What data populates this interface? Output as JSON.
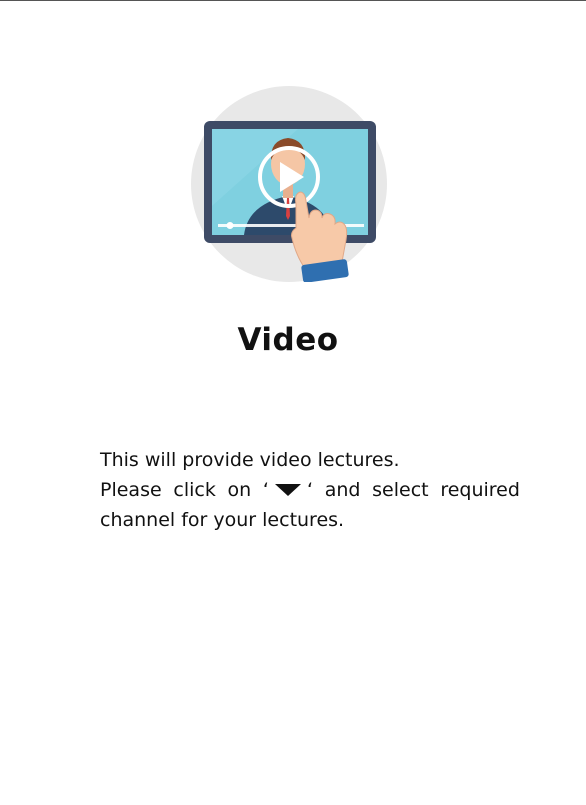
{
  "page": {
    "title": "Video",
    "illustration_icon": "video-lecture-icon",
    "description": {
      "line1": "This will provide video lectures.",
      "line2_words": [
        "Please",
        "click",
        "on"
      ],
      "quote_open": "‘",
      "quote_close": "‘",
      "dropdown_icon": "caret-down-icon",
      "line2_rest_words": [
        "and",
        "select",
        "required"
      ],
      "line3": "channel for your lectures."
    }
  },
  "colors": {
    "circle_bg": "#e8e8e8",
    "monitor_frame": "#3e4b66",
    "screen": "#7fd0e0",
    "screen_accent": "#5bbfd6",
    "skin": "#f5c6a5",
    "suit": "#2d4a6b",
    "text": "#111111"
  }
}
